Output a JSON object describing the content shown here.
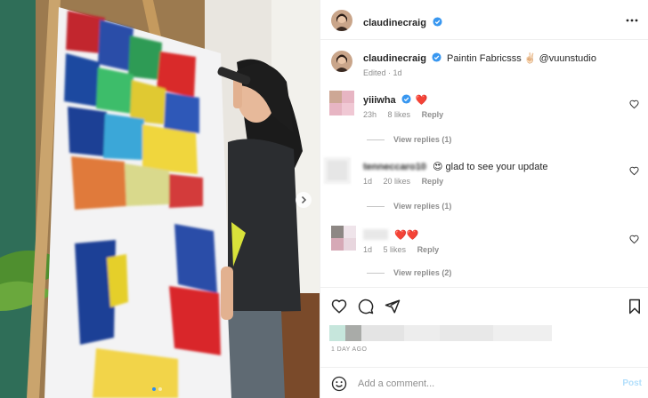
{
  "post": {
    "author": "claudinecraig",
    "caption_user": "claudinecraig",
    "caption_text": "Paintin Fabricsss ✌🏻 @vuunstudio",
    "caption_meta": "Edited · 1d"
  },
  "comments": [
    {
      "user": "yiiiwha",
      "text": "❤️",
      "time": "23h",
      "likes": "8 likes",
      "reply": "Reply",
      "view_replies": "View replies (1)"
    },
    {
      "user": "tenneccaro10",
      "text": "😍 glad to see your update",
      "time": "1d",
      "likes": "20 likes",
      "reply": "Reply",
      "view_replies": "View replies (1)"
    },
    {
      "user": "",
      "text": "❤️❤️",
      "time": "1d",
      "likes": "5 likes",
      "reply": "Reply",
      "view_replies": "View replies (2)"
    }
  ],
  "date": "1 DAY AGO",
  "add_comment": {
    "placeholder": "Add a comment...",
    "post_label": "Post"
  },
  "icons": {
    "more": "more-horizontal-icon",
    "verified": "verified-badge-icon",
    "heart": "heart-icon",
    "comment": "comment-icon",
    "share": "share-icon",
    "save": "bookmark-icon",
    "emoji": "emoji-icon",
    "next": "chevron-right-icon"
  },
  "colors": {
    "verified": "#3897f0",
    "link": "#00376b",
    "muted": "#8e8e8e",
    "post_disabled": "#b2dffc"
  }
}
